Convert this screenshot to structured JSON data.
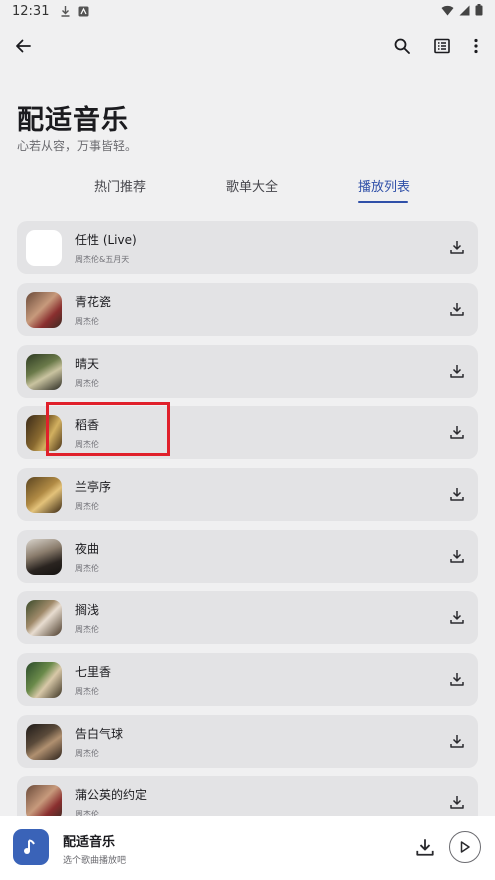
{
  "status": {
    "time": "12:31"
  },
  "header": {
    "title": "配适音乐",
    "subtitle": "心若从容，万事皆轻。"
  },
  "tabs": [
    {
      "label": "热门推荐",
      "active": false
    },
    {
      "label": "歌单大全",
      "active": false
    },
    {
      "label": "播放列表",
      "active": true
    }
  ],
  "songs": [
    {
      "title": "任性 (Live)",
      "artist": "周杰伦&五月天"
    },
    {
      "title": "青花瓷",
      "artist": "周杰伦"
    },
    {
      "title": "晴天",
      "artist": "周杰伦"
    },
    {
      "title": "稻香",
      "artist": "周杰伦"
    },
    {
      "title": "兰亭序",
      "artist": "周杰伦"
    },
    {
      "title": "夜曲",
      "artist": "周杰伦"
    },
    {
      "title": "搁浅",
      "artist": "周杰伦"
    },
    {
      "title": "七里香",
      "artist": "周杰伦"
    },
    {
      "title": "告白气球",
      "artist": "周杰伦"
    },
    {
      "title": "蒲公英的约定",
      "artist": "周杰伦"
    }
  ],
  "player": {
    "title": "配适音乐",
    "subtitle": "选个歌曲播放吧"
  },
  "colors": {
    "accent": "#2f4fa8",
    "highlight": "#e0202b",
    "player_cover": "#3a63b8"
  }
}
